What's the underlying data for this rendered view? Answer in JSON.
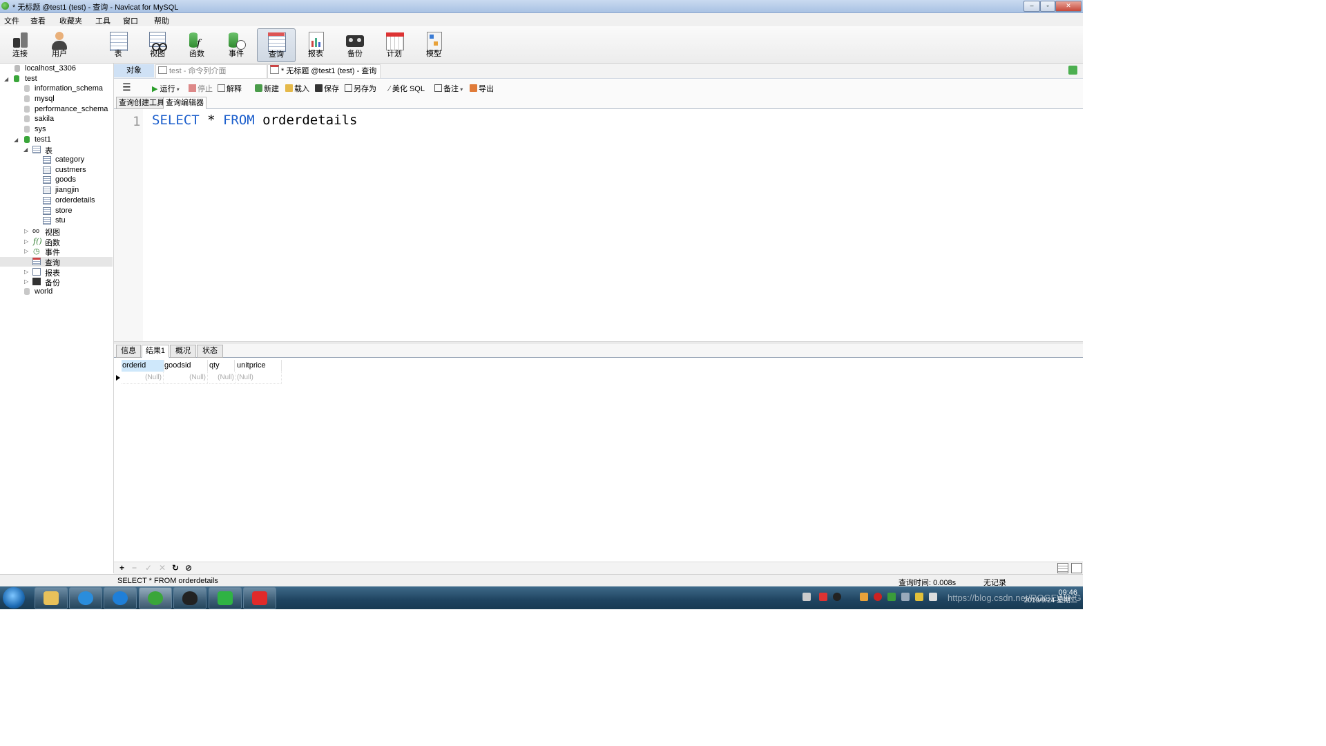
{
  "window": {
    "title": "* 无标题 @test1 (test) - 查询 - Navicat for MySQL"
  },
  "menu": [
    "文件",
    "查看",
    "收藏夹",
    "工具",
    "窗口",
    "帮助"
  ],
  "toolbar": [
    {
      "label": "连接",
      "icon": "plug-icon"
    },
    {
      "label": "用户",
      "icon": "user-icon"
    },
    {
      "label": "表",
      "icon": "table-icon"
    },
    {
      "label": "视图",
      "icon": "view-icon"
    },
    {
      "label": "函数",
      "icon": "function-icon"
    },
    {
      "label": "事件",
      "icon": "event-icon"
    },
    {
      "label": "查询",
      "icon": "query-icon"
    },
    {
      "label": "报表",
      "icon": "report-icon"
    },
    {
      "label": "备份",
      "icon": "backup-icon"
    },
    {
      "label": "计划",
      "icon": "calendar-icon"
    },
    {
      "label": "模型",
      "icon": "model-icon"
    }
  ],
  "tree": {
    "connection": "localhost_3306",
    "test": "test",
    "dbs": [
      "information_schema",
      "mysql",
      "performance_schema",
      "sakila",
      "sys"
    ],
    "test1": "test1",
    "tables_folder": "表",
    "tables": [
      "category",
      "custmers",
      "goods",
      "jiangjin",
      "orderdetails",
      "store",
      "stu"
    ],
    "folders": [
      "视图",
      "函数",
      "事件",
      "查询",
      "报表",
      "备份"
    ],
    "world": "world"
  },
  "tabs": {
    "objects": "对象",
    "cmd": "test - 命令列介面",
    "query": "* 无标题 @test1 (test) - 查询"
  },
  "query_toolbar": {
    "run": "运行",
    "stop": "停止",
    "explain": "解释",
    "new": "新建",
    "load": "载入",
    "save": "保存",
    "save_as": "另存为",
    "beautify": "美化 SQL",
    "comment": "备注",
    "export": "导出"
  },
  "subtabs": [
    "查询创建工具",
    "查询编辑器"
  ],
  "editor": {
    "line_number": "1",
    "kw1": "SELECT",
    "star": " * ",
    "kw2": "FROM",
    "table": " orderdetails"
  },
  "result_tabs": [
    "信息",
    "结果1",
    "概况",
    "状态"
  ],
  "grid": {
    "columns": [
      "orderid",
      "goodsid",
      "qty",
      "unitprice"
    ],
    "row": [
      "(Null)",
      "(Null)",
      "(Null)",
      "(Null)"
    ]
  },
  "status": {
    "sql": "SELECT * FROM orderdetails",
    "query_time": "查询时间: 0.008s",
    "records": "无记录"
  },
  "taskbar": {
    "clock_time": "09:46",
    "clock_date": "2019/9/24 星期二",
    "watermark": "https://blog.csdn.net/ROGEWING"
  }
}
